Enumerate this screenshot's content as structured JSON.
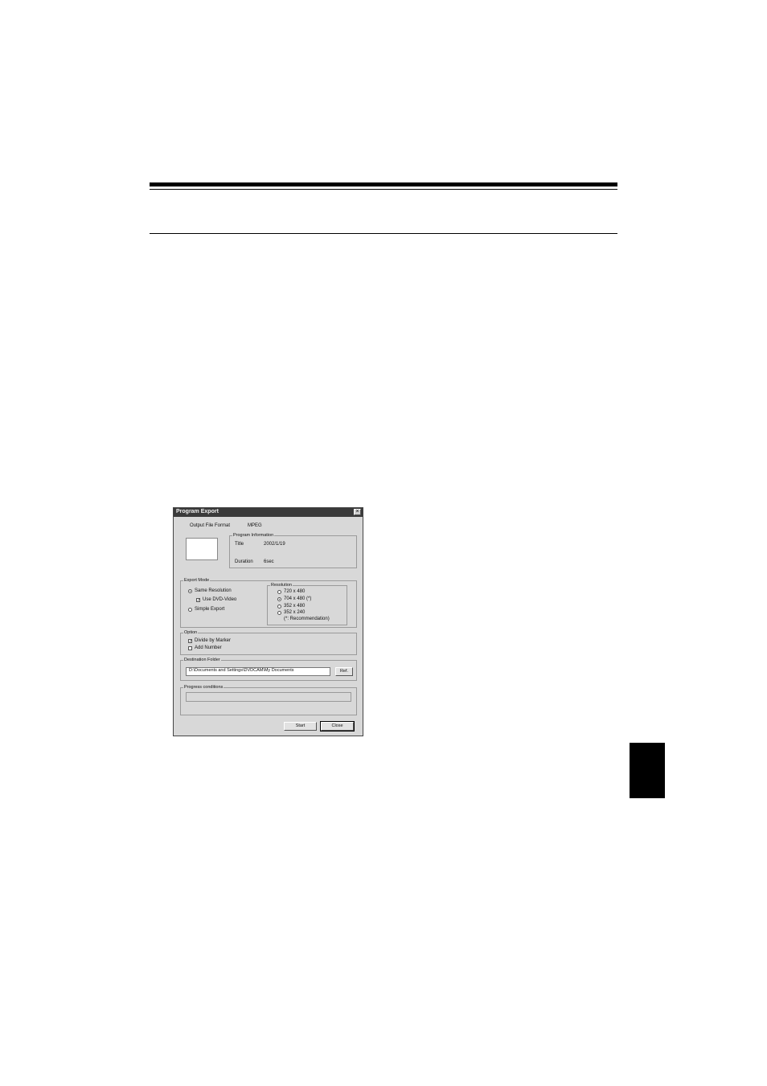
{
  "dialog": {
    "title": "Program Export",
    "close_glyph": "×",
    "output_format_label": "Output File Format",
    "output_format_value": "MPEG",
    "program_info": {
      "group_label": "Program Information",
      "title_label": "Title",
      "title_value": "2002/1/19",
      "duration_label": "Duration",
      "duration_value": "6sec"
    },
    "export_mode": {
      "group_label": "Export Mode",
      "same_resolution": "Same Resolution",
      "use_dvd_video": "Use DVD-Video",
      "simple_export": "Simple Export",
      "selected": "Same Resolution"
    },
    "resolution": {
      "group_label": "Resolution",
      "options": [
        "720 x 480",
        "704 x 480 (*)",
        "352 x 480",
        "352 x 240"
      ],
      "selected": "704 x 480 (*)",
      "note": "(*: Recommendation)"
    },
    "option": {
      "group_label": "Option",
      "divide_by_marker": "Divide by Marker",
      "divide_checked": true,
      "add_number": "Add Number",
      "add_checked": false,
      "check_glyph": "✓"
    },
    "destination": {
      "group_label": "Destination Folder",
      "path": "D:\\Documents and Settings\\DVDCAM\\My Documents",
      "ref_button": "Ref."
    },
    "progress": {
      "group_label": "Progress conditions",
      "value": 0
    },
    "buttons": {
      "start": "Start",
      "close": "Close"
    }
  },
  "colors": {
    "titlebar": "#3a3a3a",
    "dialog_bg": "#d8d8d8",
    "page_bg": "#ffffff",
    "rule": "#000000"
  }
}
